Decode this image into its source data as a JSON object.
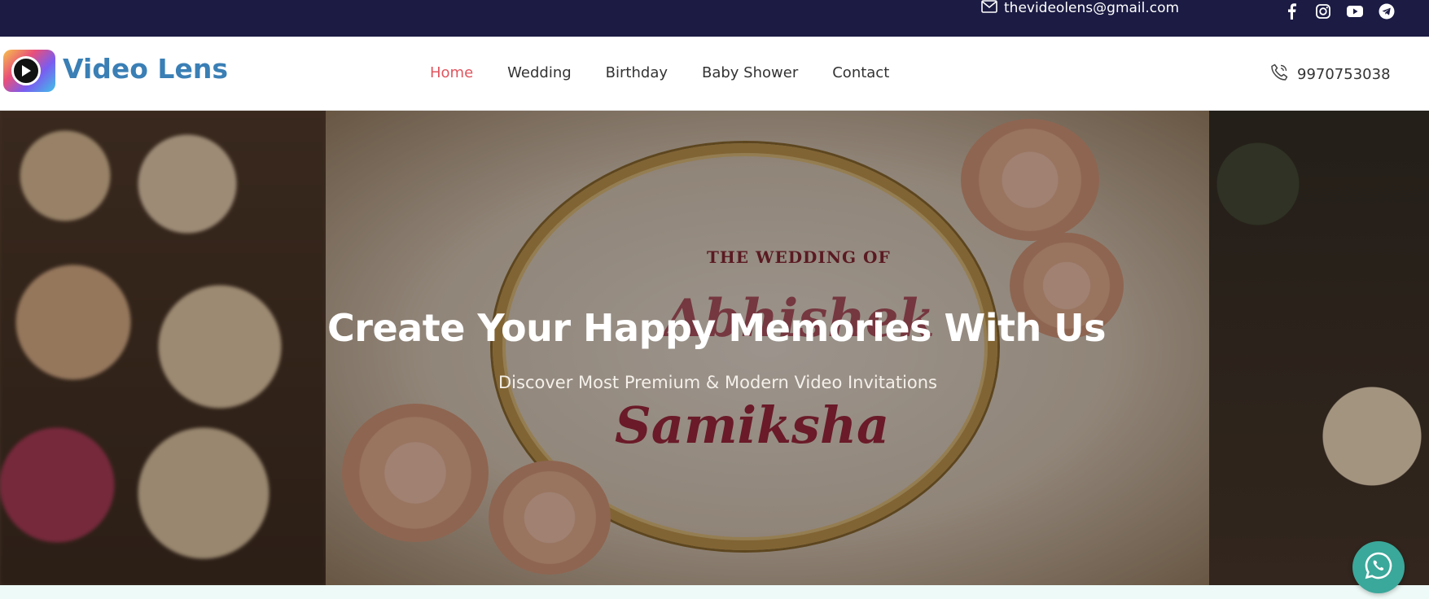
{
  "topbar": {
    "email": "thevideolens@gmail.com",
    "icons": [
      "mail-icon",
      "facebook-icon",
      "instagram-icon",
      "youtube-icon",
      "telegram-icon"
    ]
  },
  "header": {
    "logo_text": "Video Lens",
    "nav": [
      {
        "label": "Home",
        "active": true
      },
      {
        "label": "Wedding",
        "active": false
      },
      {
        "label": "Birthday",
        "active": false
      },
      {
        "label": "Baby Shower",
        "active": false
      },
      {
        "label": "Contact",
        "active": false
      }
    ],
    "phone": "9970753038"
  },
  "hero": {
    "title": "Create Your Happy Memories With Us",
    "subtitle": "Discover Most Premium & Modern Video Invitations",
    "card_heading": "THE WEDDING OF",
    "card_name_1": "Abhishek",
    "card_name_2": "Samiksha"
  },
  "colors": {
    "topbar": "#1b1b44",
    "nav_active": "#e0555f",
    "logo_text": "#3a7fb5",
    "whatsapp": "#3aa89a"
  }
}
